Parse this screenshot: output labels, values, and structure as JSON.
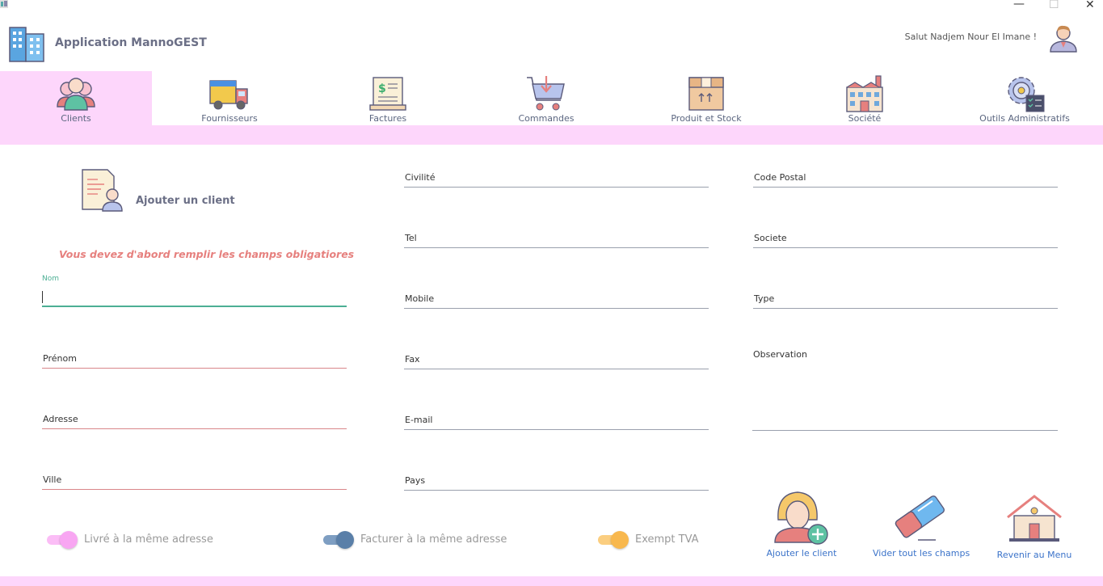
{
  "window": {
    "minimize": "—",
    "maximize": "☐",
    "close": "✕"
  },
  "header": {
    "app_title": "Application MannoGEST",
    "greeting": "Salut Nadjem Nour El Imane !"
  },
  "nav": {
    "items": [
      {
        "label": "Clients",
        "icon": "clients-icon",
        "active": true
      },
      {
        "label": "Fournisseurs",
        "icon": "truck-icon"
      },
      {
        "label": "Factures",
        "icon": "invoice-icon"
      },
      {
        "label": "Commandes",
        "icon": "cart-icon"
      },
      {
        "label": "Produit et Stock",
        "icon": "box-icon"
      },
      {
        "label": "Société",
        "icon": "factory-icon"
      },
      {
        "label": "Outils Administratifs",
        "icon": "admin-gear-icon"
      }
    ]
  },
  "form": {
    "title": "Ajouter un client",
    "warning": "Vous devez d'abord remplir les champs obligatiores",
    "fields": {
      "nom": {
        "label": "Nom",
        "value": ""
      },
      "prenom": {
        "label": "Prénom"
      },
      "adresse": {
        "label": "Adresse"
      },
      "ville": {
        "label": "Ville"
      },
      "civilite": {
        "label": "Civilité"
      },
      "tel": {
        "label": "Tel"
      },
      "mobile": {
        "label": "Mobile"
      },
      "fax": {
        "label": "Fax"
      },
      "email": {
        "label": "E-mail"
      },
      "pays": {
        "label": "Pays"
      },
      "code_postal": {
        "label": "Code Postal"
      },
      "societe": {
        "label": "Societe"
      },
      "type": {
        "label": "Type"
      },
      "observation": {
        "label": "Observation"
      }
    },
    "toggles": [
      {
        "label": "Livré à la même adresse",
        "on": true,
        "color": "#f8a6f2"
      },
      {
        "label": "Facturer à la même adresse",
        "on": true,
        "color": "#5a7fa8"
      },
      {
        "label": "Exempt TVA",
        "on": true,
        "color": "#f8b84e"
      }
    ]
  },
  "actions": {
    "add": "Ajouter le client",
    "clear": "Vider tout les champs",
    "back": "Revenir au Menu"
  },
  "colors": {
    "accent_pink": "#fdd6fb",
    "focus_green": "#4caf94",
    "required_red": "#d9868a",
    "link_blue": "#3b73c9",
    "warning": "#e6807e"
  }
}
